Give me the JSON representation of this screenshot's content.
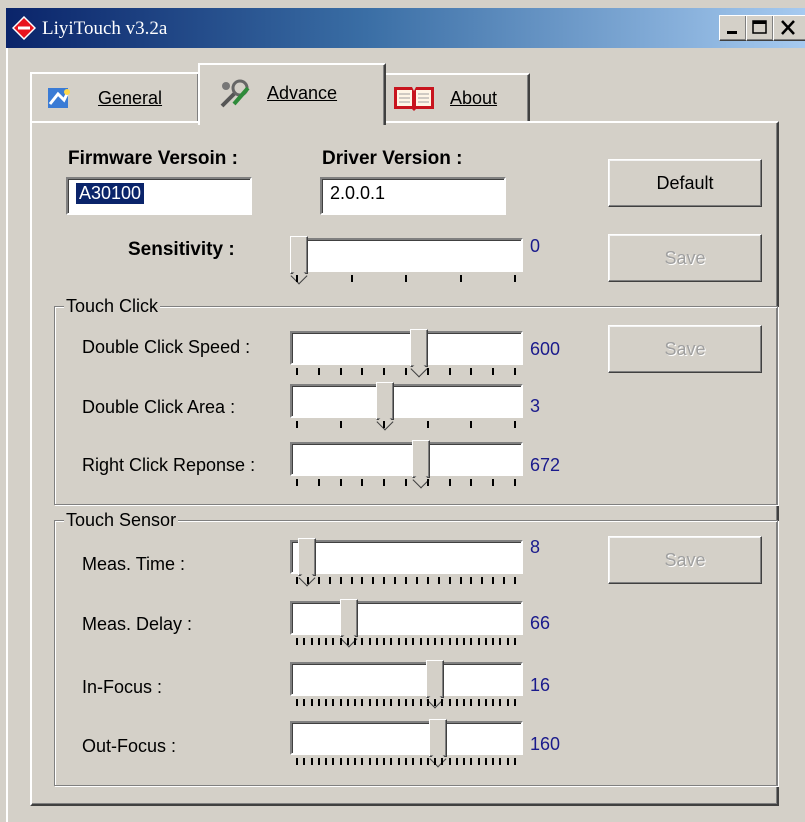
{
  "window": {
    "title": "LiyiTouch v3.2a"
  },
  "tabs": [
    {
      "label": "General"
    },
    {
      "label": "Advance"
    },
    {
      "label": "About"
    }
  ],
  "firmware": {
    "label": "Firmware Versoin :",
    "value": "A30100"
  },
  "driver": {
    "label": "Driver Version :",
    "value": "2.0.0.1"
  },
  "default_button": "Default",
  "sensitivity": {
    "label": "Sensitivity :",
    "value": "0"
  },
  "save_label": "Save",
  "touch_click": {
    "title": "Touch Click",
    "rows": [
      {
        "label": "Double Click Speed :",
        "value": "600",
        "level": 0.56
      },
      {
        "label": "Double Click Area :",
        "value": "3",
        "level": 0.4
      },
      {
        "label": "Right Click Reponse :",
        "value": "672",
        "level": 0.57
      }
    ]
  },
  "touch_sensor": {
    "title": "Touch Sensor",
    "rows": [
      {
        "label": "Meas. Time :",
        "value": "8",
        "level": 0.03
      },
      {
        "label": "Meas. Delay :",
        "value": "66",
        "level": 0.23
      },
      {
        "label": "In-Focus :",
        "value": "16",
        "level": 0.64
      },
      {
        "label": "Out-Focus :",
        "value": "160",
        "level": 0.65
      }
    ]
  },
  "colors": {
    "title_bar": "#0a246a",
    "face": "#d4d0c8",
    "value_text": "#1a1a8c"
  }
}
